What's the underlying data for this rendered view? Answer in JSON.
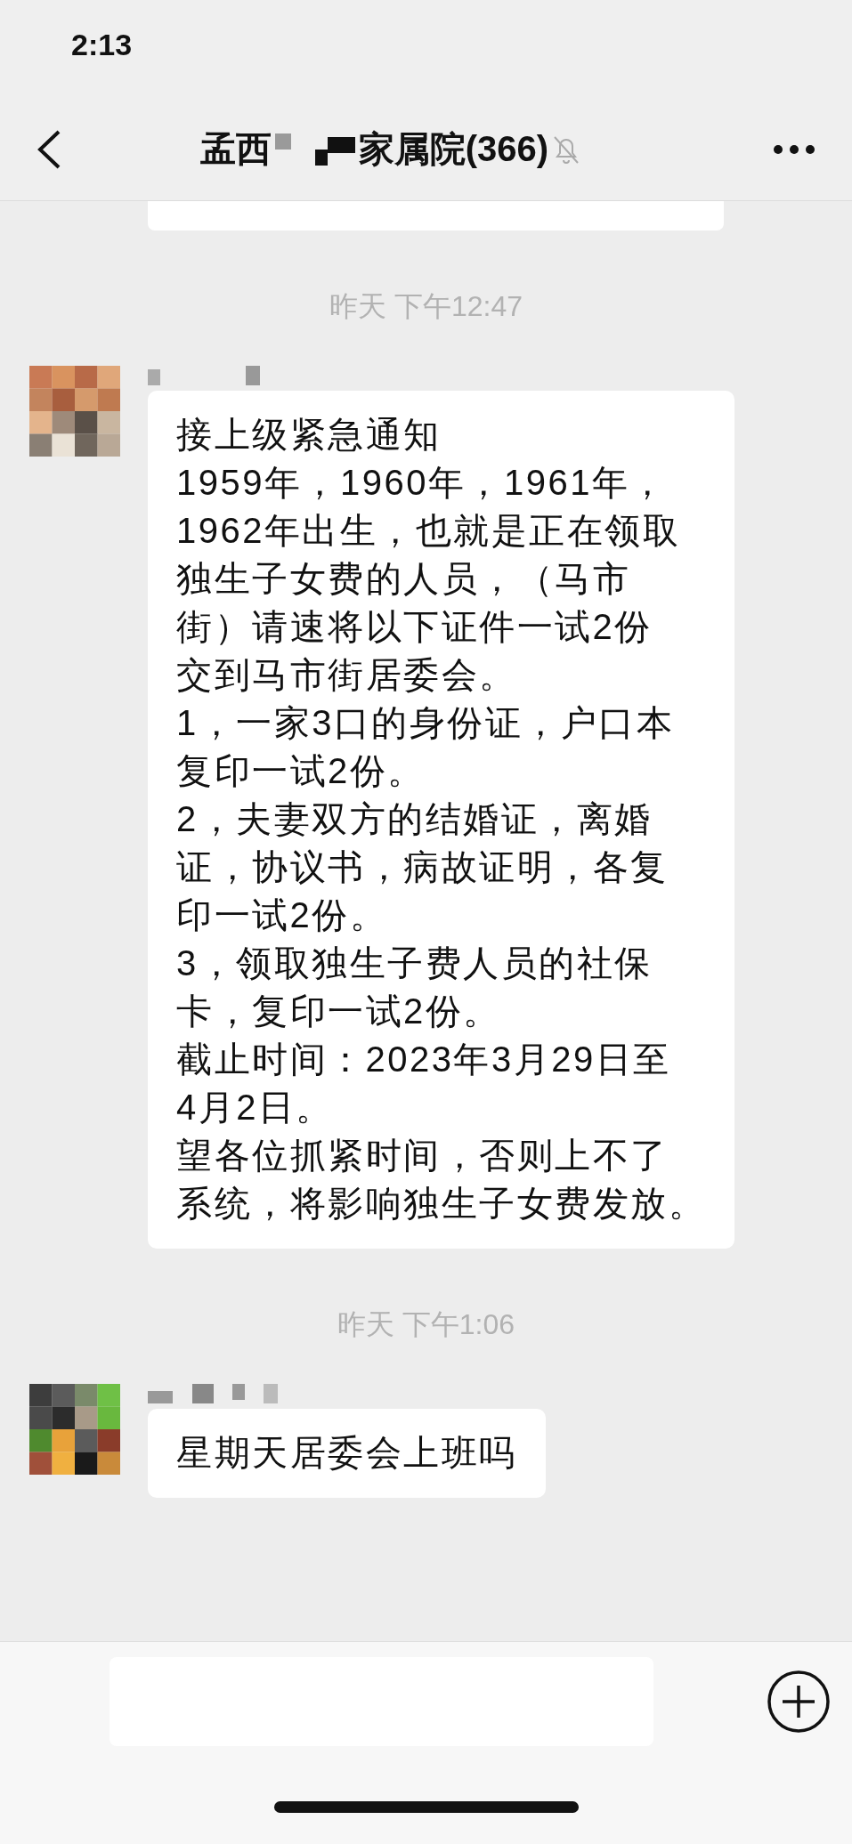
{
  "status_bar": {
    "time": "2:13"
  },
  "header": {
    "title_start": "孟西",
    "title_end": "家属院(366)",
    "muted": true
  },
  "messages": [
    {
      "kind": "partial_bubble"
    },
    {
      "kind": "time",
      "text": "昨天 下午12:47"
    },
    {
      "kind": "text",
      "lines": [
        "接上级紧急通知",
        "1959年，1960年，1961年，",
        "1962年出生，也就是正在领取",
        "独生子女费的人员，（马市",
        "街）请速将以下证件一试2份",
        "交到马市街居委会。",
        "1，一家3口的身份证，户口本",
        "复印一试2份。",
        "2，夫妻双方的结婚证，离婚",
        "证，协议书，病故证明，各复",
        "印一试2份。",
        "3，领取独生子费人员的社保",
        "卡，复印一试2份。",
        "截止时间：2023年3月29日至",
        "4月2日。",
        "望各位抓紧时间，否则上不了",
        "系统，将影响独生子女费发放。"
      ]
    },
    {
      "kind": "time",
      "text": "昨天 下午1:06"
    },
    {
      "kind": "text",
      "lines": [
        "星期天居委会上班吗"
      ]
    }
  ]
}
